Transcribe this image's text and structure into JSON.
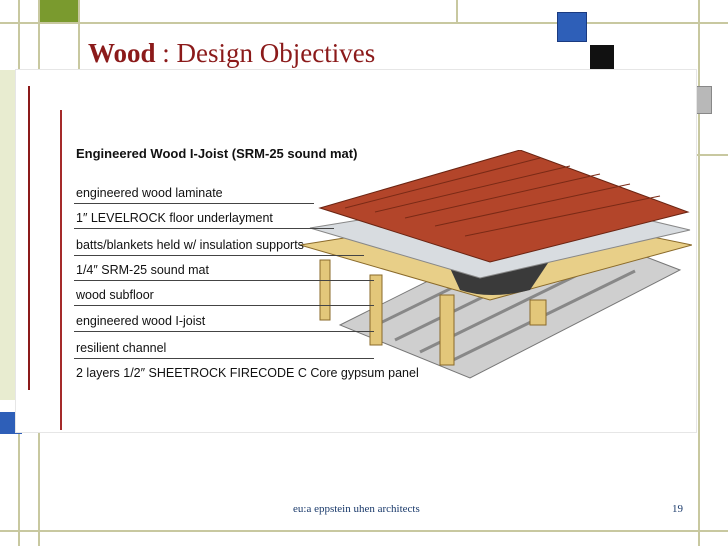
{
  "slide": {
    "title_bold": "Wood",
    "title_rest": " : Design Objectives",
    "footer_text": "eu:a   eppstein uhen architects",
    "page_number": "19"
  },
  "diagram": {
    "heading": "Engineered Wood I-Joist (SRM-25 sound mat)",
    "layers": [
      "engineered wood laminate",
      "1″ LEVELROCK floor underlayment",
      "batts/blankets held w/ insulation supports",
      "1/4″ SRM-25 sound mat",
      "wood subfloor",
      "engineered wood I-joist",
      "resilient channel",
      "2 layers 1/2″ SHEETROCK FIRECODE C Core gypsum panel"
    ]
  },
  "colors": {
    "title": "#8b1a1a",
    "accent_blue": "#2e5fb8",
    "accent_green": "#7a9a2e",
    "footer": "#1a3a6b"
  }
}
